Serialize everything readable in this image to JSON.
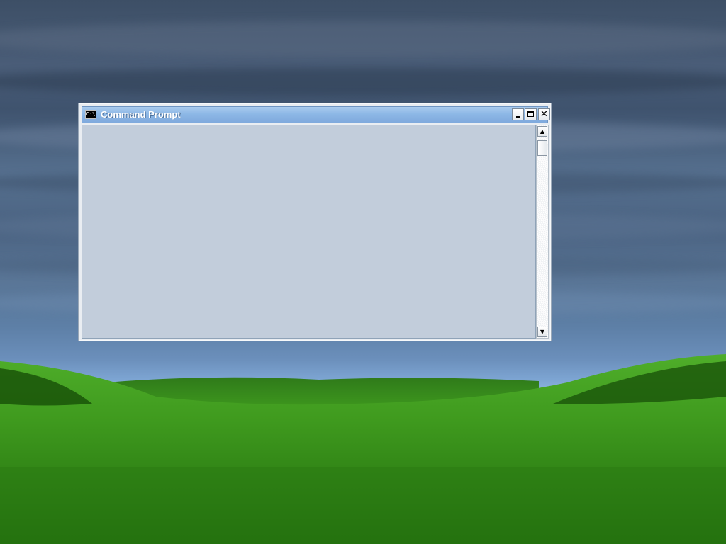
{
  "window": {
    "title": "Command Prompt",
    "icon": "command-prompt-icon",
    "icon_glyph": "C:\\",
    "buttons": {
      "minimize_icon": "minimize-icon",
      "maximize_icon": "maximize-icon",
      "close_icon": "close-icon",
      "close_glyph": "✕"
    },
    "scrollbar": {
      "up_glyph": "▲",
      "down_glyph": "▼",
      "position": 0
    }
  },
  "desktop": {
    "wallpaper": "stormy-sky-green-hills"
  },
  "colors": {
    "titlebar": "#8db8e6",
    "sky": "#4a5d78",
    "grass": "#3f9a1e"
  }
}
